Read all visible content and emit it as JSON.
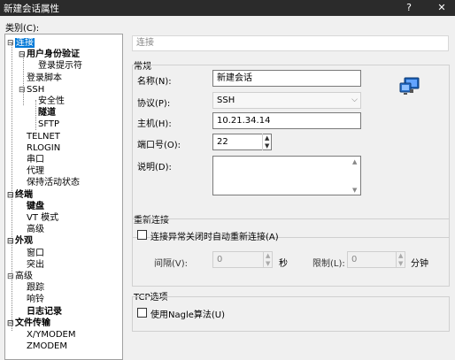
{
  "window": {
    "title": "新建会话属性",
    "help_glyph": "?",
    "close_glyph": "✕"
  },
  "category_label": "类别(C):",
  "tree": [
    {
      "id": "connection",
      "label": "连接",
      "expander": "⊟",
      "bold": false,
      "selected": true
    },
    {
      "id": "user-auth",
      "label": "用户身份验证",
      "expander": "⊟",
      "bold": true
    },
    {
      "id": "login-prompt",
      "label": "登录提示符",
      "expander": "",
      "bold": false
    },
    {
      "id": "login-script",
      "label": "登录脚本",
      "expander": "",
      "bold": false
    },
    {
      "id": "ssh",
      "label": "SSH",
      "expander": "⊟",
      "bold": false
    },
    {
      "id": "security",
      "label": "安全性",
      "expander": "",
      "bold": false
    },
    {
      "id": "tunnel",
      "label": "隧道",
      "expander": "",
      "bold": true
    },
    {
      "id": "sftp",
      "label": "SFTP",
      "expander": "",
      "bold": false
    },
    {
      "id": "telnet",
      "label": "TELNET",
      "expander": "",
      "bold": false
    },
    {
      "id": "rlogin",
      "label": "RLOGIN",
      "expander": "",
      "bold": false
    },
    {
      "id": "serial",
      "label": "串口",
      "expander": "",
      "bold": false
    },
    {
      "id": "proxy",
      "label": "代理",
      "expander": "",
      "bold": false
    },
    {
      "id": "keepalive",
      "label": "保持活动状态",
      "expander": "",
      "bold": false
    },
    {
      "id": "terminal",
      "label": "终端",
      "expander": "⊟",
      "bold": true
    },
    {
      "id": "keyboard",
      "label": "键盘",
      "expander": "",
      "bold": true
    },
    {
      "id": "vt-mode",
      "label": "VT 模式",
      "expander": "",
      "bold": false
    },
    {
      "id": "advanced-term",
      "label": "高级",
      "expander": "",
      "bold": false
    },
    {
      "id": "appearance",
      "label": "外观",
      "expander": "⊟",
      "bold": true
    },
    {
      "id": "window",
      "label": "窗口",
      "expander": "",
      "bold": false
    },
    {
      "id": "highlight",
      "label": "突出",
      "expander": "",
      "bold": false
    },
    {
      "id": "advanced",
      "label": "高级",
      "expander": "⊟",
      "bold": false
    },
    {
      "id": "trace",
      "label": "跟踪",
      "expander": "",
      "bold": false
    },
    {
      "id": "bell",
      "label": "响铃",
      "expander": "",
      "bold": false
    },
    {
      "id": "logging",
      "label": "日志记录",
      "expander": "",
      "bold": true
    },
    {
      "id": "file-transfer",
      "label": "文件传输",
      "expander": "⊟",
      "bold": true
    },
    {
      "id": "xymodem",
      "label": "X/YMODEM",
      "expander": "",
      "bold": false
    },
    {
      "id": "zmodem",
      "label": "ZMODEM",
      "expander": "",
      "bold": false
    }
  ],
  "panel": {
    "header": "连接",
    "general": {
      "title": "常规",
      "name_label": "名称(N):",
      "name_value": "新建会话",
      "protocol_label": "协议(P):",
      "protocol_value": "SSH",
      "host_label": "主机(H):",
      "host_value": "10.21.34.14",
      "port_label": "端口号(O):",
      "port_value": "22",
      "desc_label": "说明(D):",
      "desc_value": ""
    },
    "reconnect": {
      "title": "重新连接",
      "auto_label": "连接异常关闭时自动重新连接(A)",
      "auto_checked": false,
      "interval_label": "间隔(V):",
      "interval_value": "0",
      "interval_unit": "秒",
      "limit_label": "限制(L):",
      "limit_value": "0",
      "limit_unit": "分钟"
    },
    "tcp": {
      "title": "TCP选项",
      "nagle_label": "使用Nagle算法(U)",
      "nagle_checked": false
    }
  },
  "icons": {
    "session": "computer-network-icon"
  }
}
